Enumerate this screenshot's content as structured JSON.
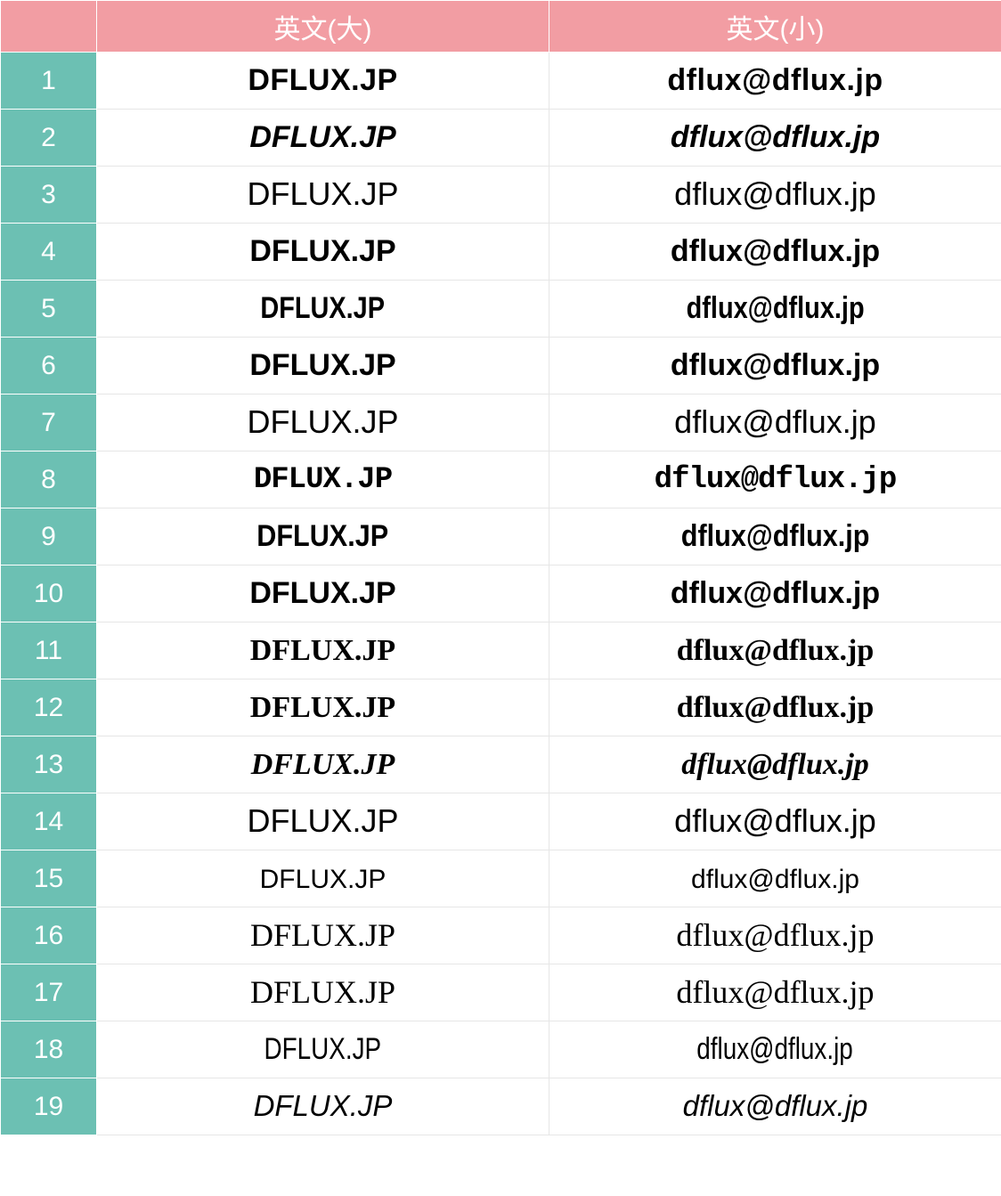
{
  "headers": {
    "col_big": "英文(大)",
    "col_small": "英文(小)"
  },
  "rows": [
    {
      "num": "1",
      "big": "DFLUX.JP",
      "small": "dflux@dflux.jp"
    },
    {
      "num": "2",
      "big": "DFLUX.JP",
      "small": "dflux@dflux.jp"
    },
    {
      "num": "3",
      "big": "DFLUX.JP",
      "small": "dflux@dflux.jp"
    },
    {
      "num": "4",
      "big": "DFLUX.JP",
      "small": "dflux@dflux.jp"
    },
    {
      "num": "5",
      "big": "DFLUX.JP",
      "small": "dflux@dflux.jp"
    },
    {
      "num": "6",
      "big": "DFLUX.JP",
      "small": "dflux@dflux.jp"
    },
    {
      "num": "7",
      "big": "DFLUX.JP",
      "small": "dflux@dflux.jp"
    },
    {
      "num": "8",
      "big": "DFLUX.JP",
      "small": "dflux@dflux.jp"
    },
    {
      "num": "9",
      "big": "DFLUX.JP",
      "small": "dflux@dflux.jp"
    },
    {
      "num": "10",
      "big": "DFLUX.JP",
      "small": "dflux@dflux.jp"
    },
    {
      "num": "11",
      "big": "DFLUX.JP",
      "small": "dflux@dflux.jp"
    },
    {
      "num": "12",
      "big": "DFLUX.JP",
      "small": "dflux@dflux.jp"
    },
    {
      "num": "13",
      "big": "DFLUX.JP",
      "small": "dflux@dflux.jp"
    },
    {
      "num": "14",
      "big": "DFLUX.JP",
      "small": "dflux@dflux.jp"
    },
    {
      "num": "15",
      "big": "DFLUX.JP",
      "small": "dflux@dflux.jp"
    },
    {
      "num": "16",
      "big": "DFLUX.JP",
      "small": "dflux@dflux.jp"
    },
    {
      "num": "17",
      "big": "DFLUX.JP",
      "small": "dflux@dflux.jp"
    },
    {
      "num": "18",
      "big": "DFLUX.JP",
      "small": "dflux@dflux.jp"
    },
    {
      "num": "19",
      "big": "DFLUX.JP",
      "small": "dflux@dflux.jp"
    }
  ],
  "colors": {
    "header_bg": "#f29da3",
    "num_bg": "#6cc0b3"
  }
}
